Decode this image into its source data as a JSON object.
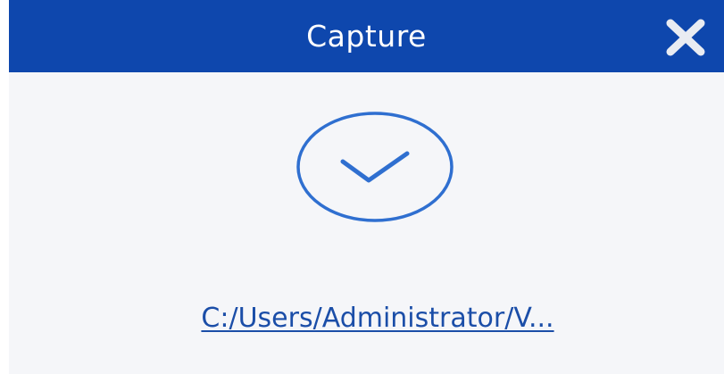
{
  "window": {
    "title": "Capture",
    "close_icon": "close-icon"
  },
  "status": {
    "icon": "check-circle-icon"
  },
  "result": {
    "path_link": "C:/Users/Administrator/V..."
  },
  "colors": {
    "titlebar": "#0e47ad",
    "background": "#f5f6f9",
    "accent": "#2f6fd0",
    "link": "#1b4ea8"
  }
}
